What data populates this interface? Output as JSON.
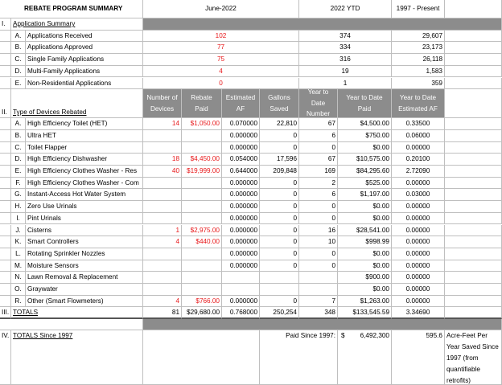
{
  "title": "REBATE PROGRAM SUMMARY",
  "period_label": "June-2022",
  "ytd_label": "2022  YTD",
  "since_label": "1997 - Present",
  "section1": {
    "num": "I.",
    "title": "Application Summary",
    "rows": [
      {
        "letter": "A.",
        "label": "Applications Received",
        "month": "102",
        "ytd": "374",
        "since": "29,607"
      },
      {
        "letter": "B.",
        "label": "Applications Approved",
        "month": "77",
        "ytd": "334",
        "since": "23,173"
      },
      {
        "letter": "C.",
        "label": "Single Family Applications",
        "month": "75",
        "ytd": "316",
        "since": "26,118"
      },
      {
        "letter": "D.",
        "label": "Multi-Family Applications",
        "month": "4",
        "ytd": "19",
        "since": "1,583"
      },
      {
        "letter": "E.",
        "label": "Non-Residential Applications",
        "month": "0",
        "ytd": "1",
        "since": "359"
      }
    ]
  },
  "section2": {
    "num": "II.",
    "title": "Type of Devices Rebated",
    "headers": {
      "devices": "Number of Devices",
      "rebate": "Rebate Paid",
      "af": "Estimated AF",
      "gallons": "Gallons Saved",
      "ytd_number": "Year to Date Number",
      "ytd_paid": "Year to Date Paid",
      "ytd_af": "Year to Date Estimated AF"
    },
    "rows": [
      {
        "letter": "A.",
        "label": "High Efficiency Toilet (HET)",
        "devices": "14",
        "rebate": "$1,050.00",
        "af": "0.070000",
        "gallons": "22,810",
        "ytd_num": "67",
        "ytd_paid": "$4,500.00",
        "ytd_af": "0.33500"
      },
      {
        "letter": "B.",
        "label": "Ultra HET",
        "devices": "",
        "rebate": "",
        "af": "0.000000",
        "gallons": "0",
        "ytd_num": "6",
        "ytd_paid": "$750.00",
        "ytd_af": "0.06000"
      },
      {
        "letter": "C.",
        "label": "Toilet Flapper",
        "devices": "",
        "rebate": "",
        "af": "0.000000",
        "gallons": "0",
        "ytd_num": "0",
        "ytd_paid": "$0.00",
        "ytd_af": "0.00000"
      },
      {
        "letter": "D.",
        "label": "High Efficiency Dishwasher",
        "devices": "18",
        "rebate": "$4,450.00",
        "af": "0.054000",
        "gallons": "17,596",
        "ytd_num": "67",
        "ytd_paid": "$10,575.00",
        "ytd_af": "0.20100"
      },
      {
        "letter": "E.",
        "label": "High Efficiency Clothes Washer - Res",
        "devices": "40",
        "rebate": "$19,999.00",
        "af": "0.644000",
        "gallons": "209,848",
        "ytd_num": "169",
        "ytd_paid": "$84,295.60",
        "ytd_af": "2.72090"
      },
      {
        "letter": "F.",
        "label": "High Efficiency Clothes Washer - Com",
        "devices": "",
        "rebate": "",
        "af": "0.000000",
        "gallons": "0",
        "ytd_num": "2",
        "ytd_paid": "$525.00",
        "ytd_af": "0.00000"
      },
      {
        "letter": "G.",
        "label": "Instant-Access Hot Water System",
        "devices": "",
        "rebate": "",
        "af": "0.000000",
        "gallons": "0",
        "ytd_num": "6",
        "ytd_paid": "$1,197.00",
        "ytd_af": "0.03000"
      },
      {
        "letter": "H.",
        "label": "Zero Use Urinals",
        "devices": "",
        "rebate": "",
        "af": "0.000000",
        "gallons": "0",
        "ytd_num": "0",
        "ytd_paid": "$0.00",
        "ytd_af": "0.00000"
      },
      {
        "letter": "I.",
        "label": "Pint Urinals",
        "devices": "",
        "rebate": "",
        "af": "0.000000",
        "gallons": "0",
        "ytd_num": "0",
        "ytd_paid": "$0.00",
        "ytd_af": "0.00000"
      },
      {
        "letter": "J.",
        "label": "Cisterns",
        "devices": "1",
        "rebate": "$2,975.00",
        "af": "0.000000",
        "gallons": "0",
        "ytd_num": "16",
        "ytd_paid": "$28,541.00",
        "ytd_af": "0.00000"
      },
      {
        "letter": "K.",
        "label": "Smart Controllers",
        "devices": "4",
        "rebate": "$440.00",
        "af": "0.000000",
        "gallons": "0",
        "ytd_num": "10",
        "ytd_paid": "$998.99",
        "ytd_af": "0.00000"
      },
      {
        "letter": "L.",
        "label": "Rotating Sprinkler Nozzles",
        "devices": "",
        "rebate": "",
        "af": "0.000000",
        "gallons": "0",
        "ytd_num": "0",
        "ytd_paid": "$0.00",
        "ytd_af": "0.00000"
      },
      {
        "letter": "M.",
        "label": "Moisture Sensors",
        "devices": "",
        "rebate": "",
        "af": "0.000000",
        "gallons": "0",
        "ytd_num": "0",
        "ytd_paid": "$0.00",
        "ytd_af": "0.00000"
      },
      {
        "letter": "N.",
        "label": "Lawn Removal & Replacement",
        "devices": "",
        "rebate": "",
        "af": "",
        "gallons": "",
        "ytd_num": "",
        "ytd_paid": "$900.00",
        "ytd_af": "0.00000"
      },
      {
        "letter": "O.",
        "label": "Graywater",
        "devices": "",
        "rebate": "",
        "af": "",
        "gallons": "",
        "ytd_num": "",
        "ytd_paid": "$0.00",
        "ytd_af": "0.00000"
      },
      {
        "letter": "R.",
        "label": "Other (Smart Flowmeters)",
        "devices": "4",
        "rebate": "$766.00",
        "af": "0.000000",
        "gallons": "0",
        "ytd_num": "7",
        "ytd_paid": "$1,263.00",
        "ytd_af": "0.00000"
      }
    ]
  },
  "section3": {
    "num": "III.",
    "title": "TOTALS",
    "devices": "81",
    "rebate": "$29,680.00",
    "af": "0.768000",
    "gallons": "250,254",
    "ytd_num": "348",
    "ytd_paid": "$133,545.59",
    "ytd_af": "3.34690"
  },
  "section4": {
    "num": "IV.",
    "title": "TOTALS Since 1997",
    "paid_label": "Paid Since 1997:",
    "currency": "$",
    "paid_value": "6,492,300",
    "af_value": "595.6",
    "af_note": "Acre-Feet Per Year Saved Since 1997 (from quantifiable retrofits)"
  }
}
